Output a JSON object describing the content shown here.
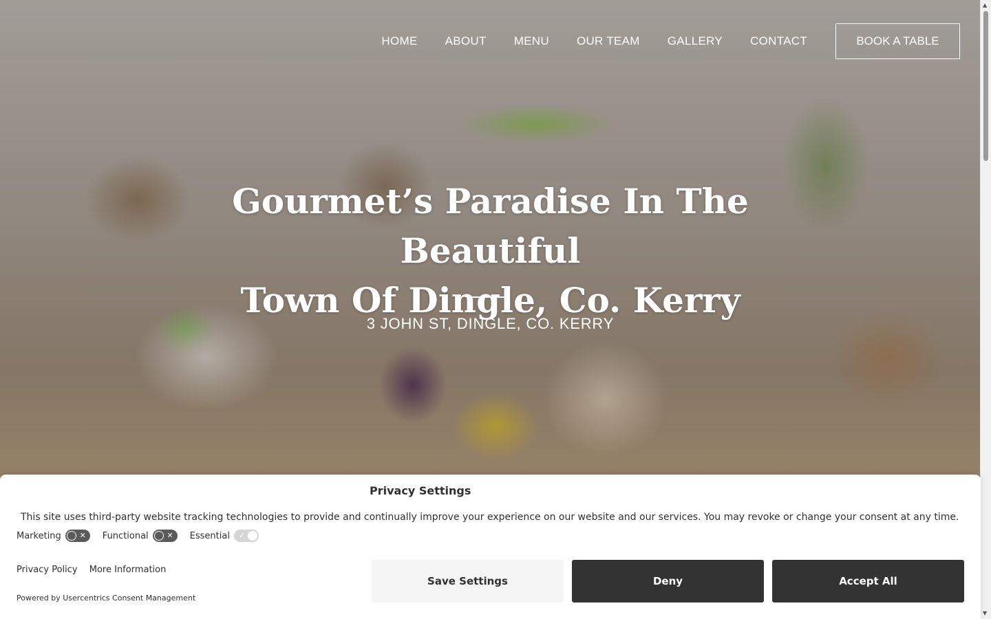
{
  "nav": {
    "items": [
      "HOME",
      "ABOUT",
      "MENU",
      "OUR TEAM",
      "GALLERY",
      "CONTACT"
    ],
    "book_label": "BOOK A TABLE"
  },
  "hero": {
    "headline_line1": "Gourmet’s Paradise In The Beautiful",
    "headline_line2": "Town Of Dingle, Co. Kerry",
    "address": "3 JOHN ST, DINGLE, CO. KERRY"
  },
  "privacy": {
    "title": "Privacy Settings",
    "text": "This site uses third-party website tracking technologies to provide and continually improve your experience on our website and our services. You may revoke or change your consent at any time.",
    "toggles": [
      {
        "label": "Marketing",
        "enabled": false,
        "disabled": false
      },
      {
        "label": "Functional",
        "enabled": false,
        "disabled": false
      },
      {
        "label": "Essential",
        "enabled": true,
        "disabled": true
      }
    ],
    "links": [
      "Privacy Policy",
      "More Information"
    ],
    "powered_by": "Powered by Usercentrics Consent Management",
    "buttons": {
      "save": "Save Settings",
      "deny": "Deny",
      "accept": "Accept All"
    }
  },
  "colors": {
    "button_dark": "#333333",
    "button_light": "#f5f5f5",
    "text_dark": "#303030"
  }
}
